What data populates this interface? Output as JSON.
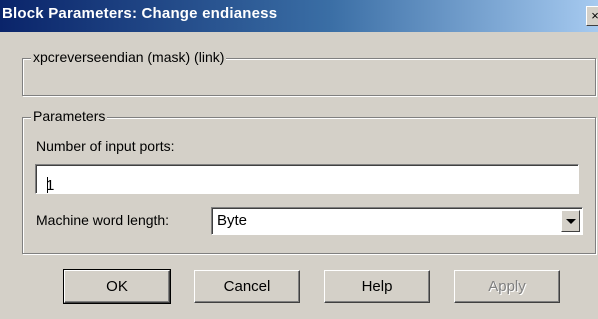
{
  "window": {
    "title": "Block Parameters: Change endianess",
    "close_glyph": "×"
  },
  "mask_group": {
    "label": "xpcreverseendian (mask) (link)"
  },
  "parameters_group": {
    "label": "Parameters",
    "input_ports_label": "Number of input ports:",
    "input_ports_value": "1",
    "word_length_label": "Machine word length:",
    "word_length_value": "Byte"
  },
  "buttons": {
    "ok": "OK",
    "cancel": "Cancel",
    "help": "Help",
    "apply": "Apply"
  }
}
